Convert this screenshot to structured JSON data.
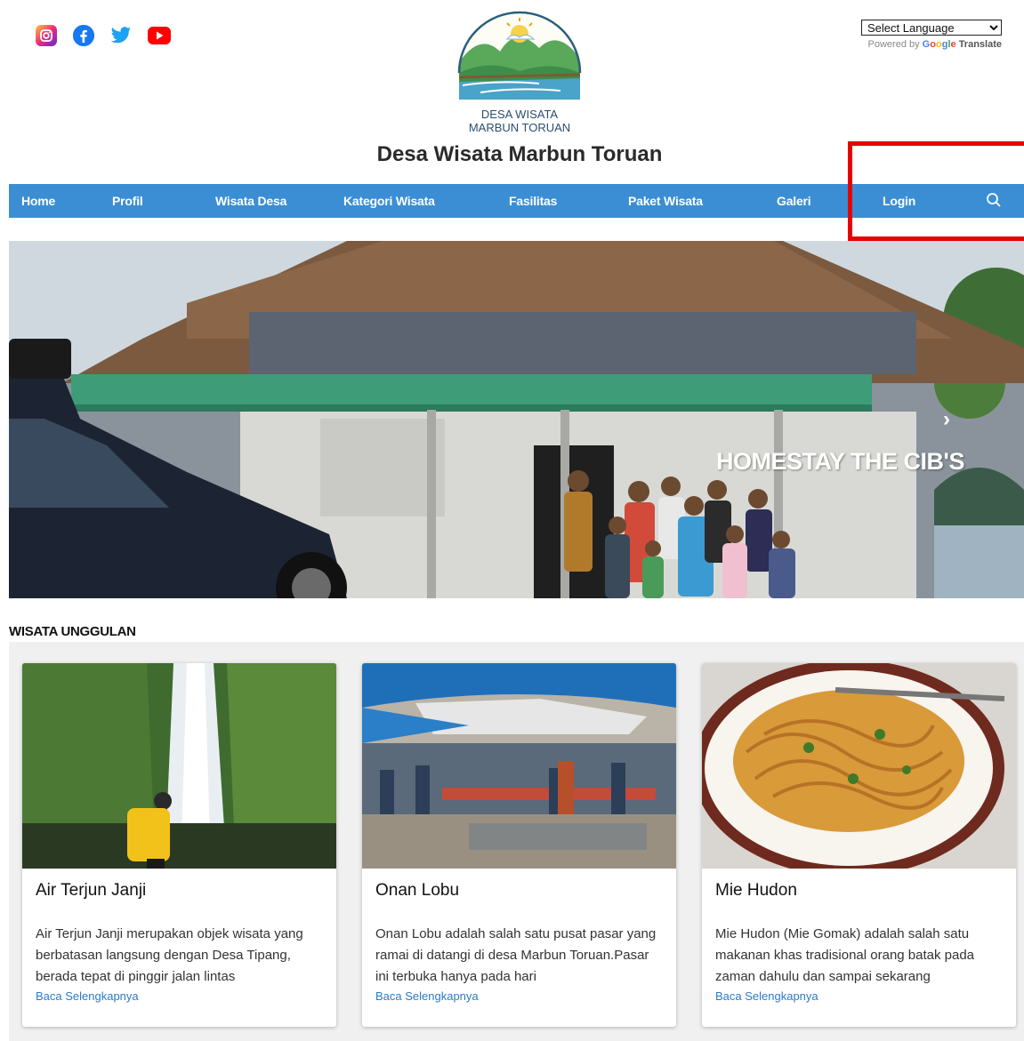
{
  "header": {
    "social": [
      {
        "name": "instagram-icon"
      },
      {
        "name": "facebook-icon"
      },
      {
        "name": "twitter-icon"
      },
      {
        "name": "youtube-icon"
      }
    ],
    "logo_text_line1": "DESA WISATA",
    "logo_text_line2": "MARBUN TORUAN",
    "site_title": "Desa Wisata Marbun Toruan",
    "language_select": "Select Language",
    "powered_by": "Powered by",
    "google": "Google",
    "translate": "Translate"
  },
  "nav": {
    "items": [
      "Home",
      "Profil",
      "Wisata Desa",
      "Kategori Wisata",
      "Fasilitas",
      "Paket Wisata",
      "Galeri",
      "Login"
    ],
    "accent": "#3b8ed3"
  },
  "hero": {
    "caption": "HOMESTAY THE CIB'S",
    "next": "›"
  },
  "section": {
    "title": "WISATA UNGGULAN"
  },
  "cards": [
    {
      "title": "Air Terjun Janji",
      "text": "Air Terjun Janji merupakan objek wisata yang berbatasan langsung dengan Desa Tipang, berada tepat di pinggir jalan lintas",
      "more": "Baca Selengkapnya"
    },
    {
      "title": "Onan Lobu",
      "text": "Onan Lobu adalah salah satu pusat pasar yang ramai di datangi di desa Marbun Toruan.Pasar ini terbuka hanya pada hari",
      "more": "Baca Selengkapnya"
    },
    {
      "title": "Mie Hudon",
      "text": "Mie Hudon (Mie Gomak) adalah salah satu makanan khas tradisional orang batak pada zaman dahulu dan sampai sekarang",
      "more": "Baca Selengkapnya"
    }
  ]
}
